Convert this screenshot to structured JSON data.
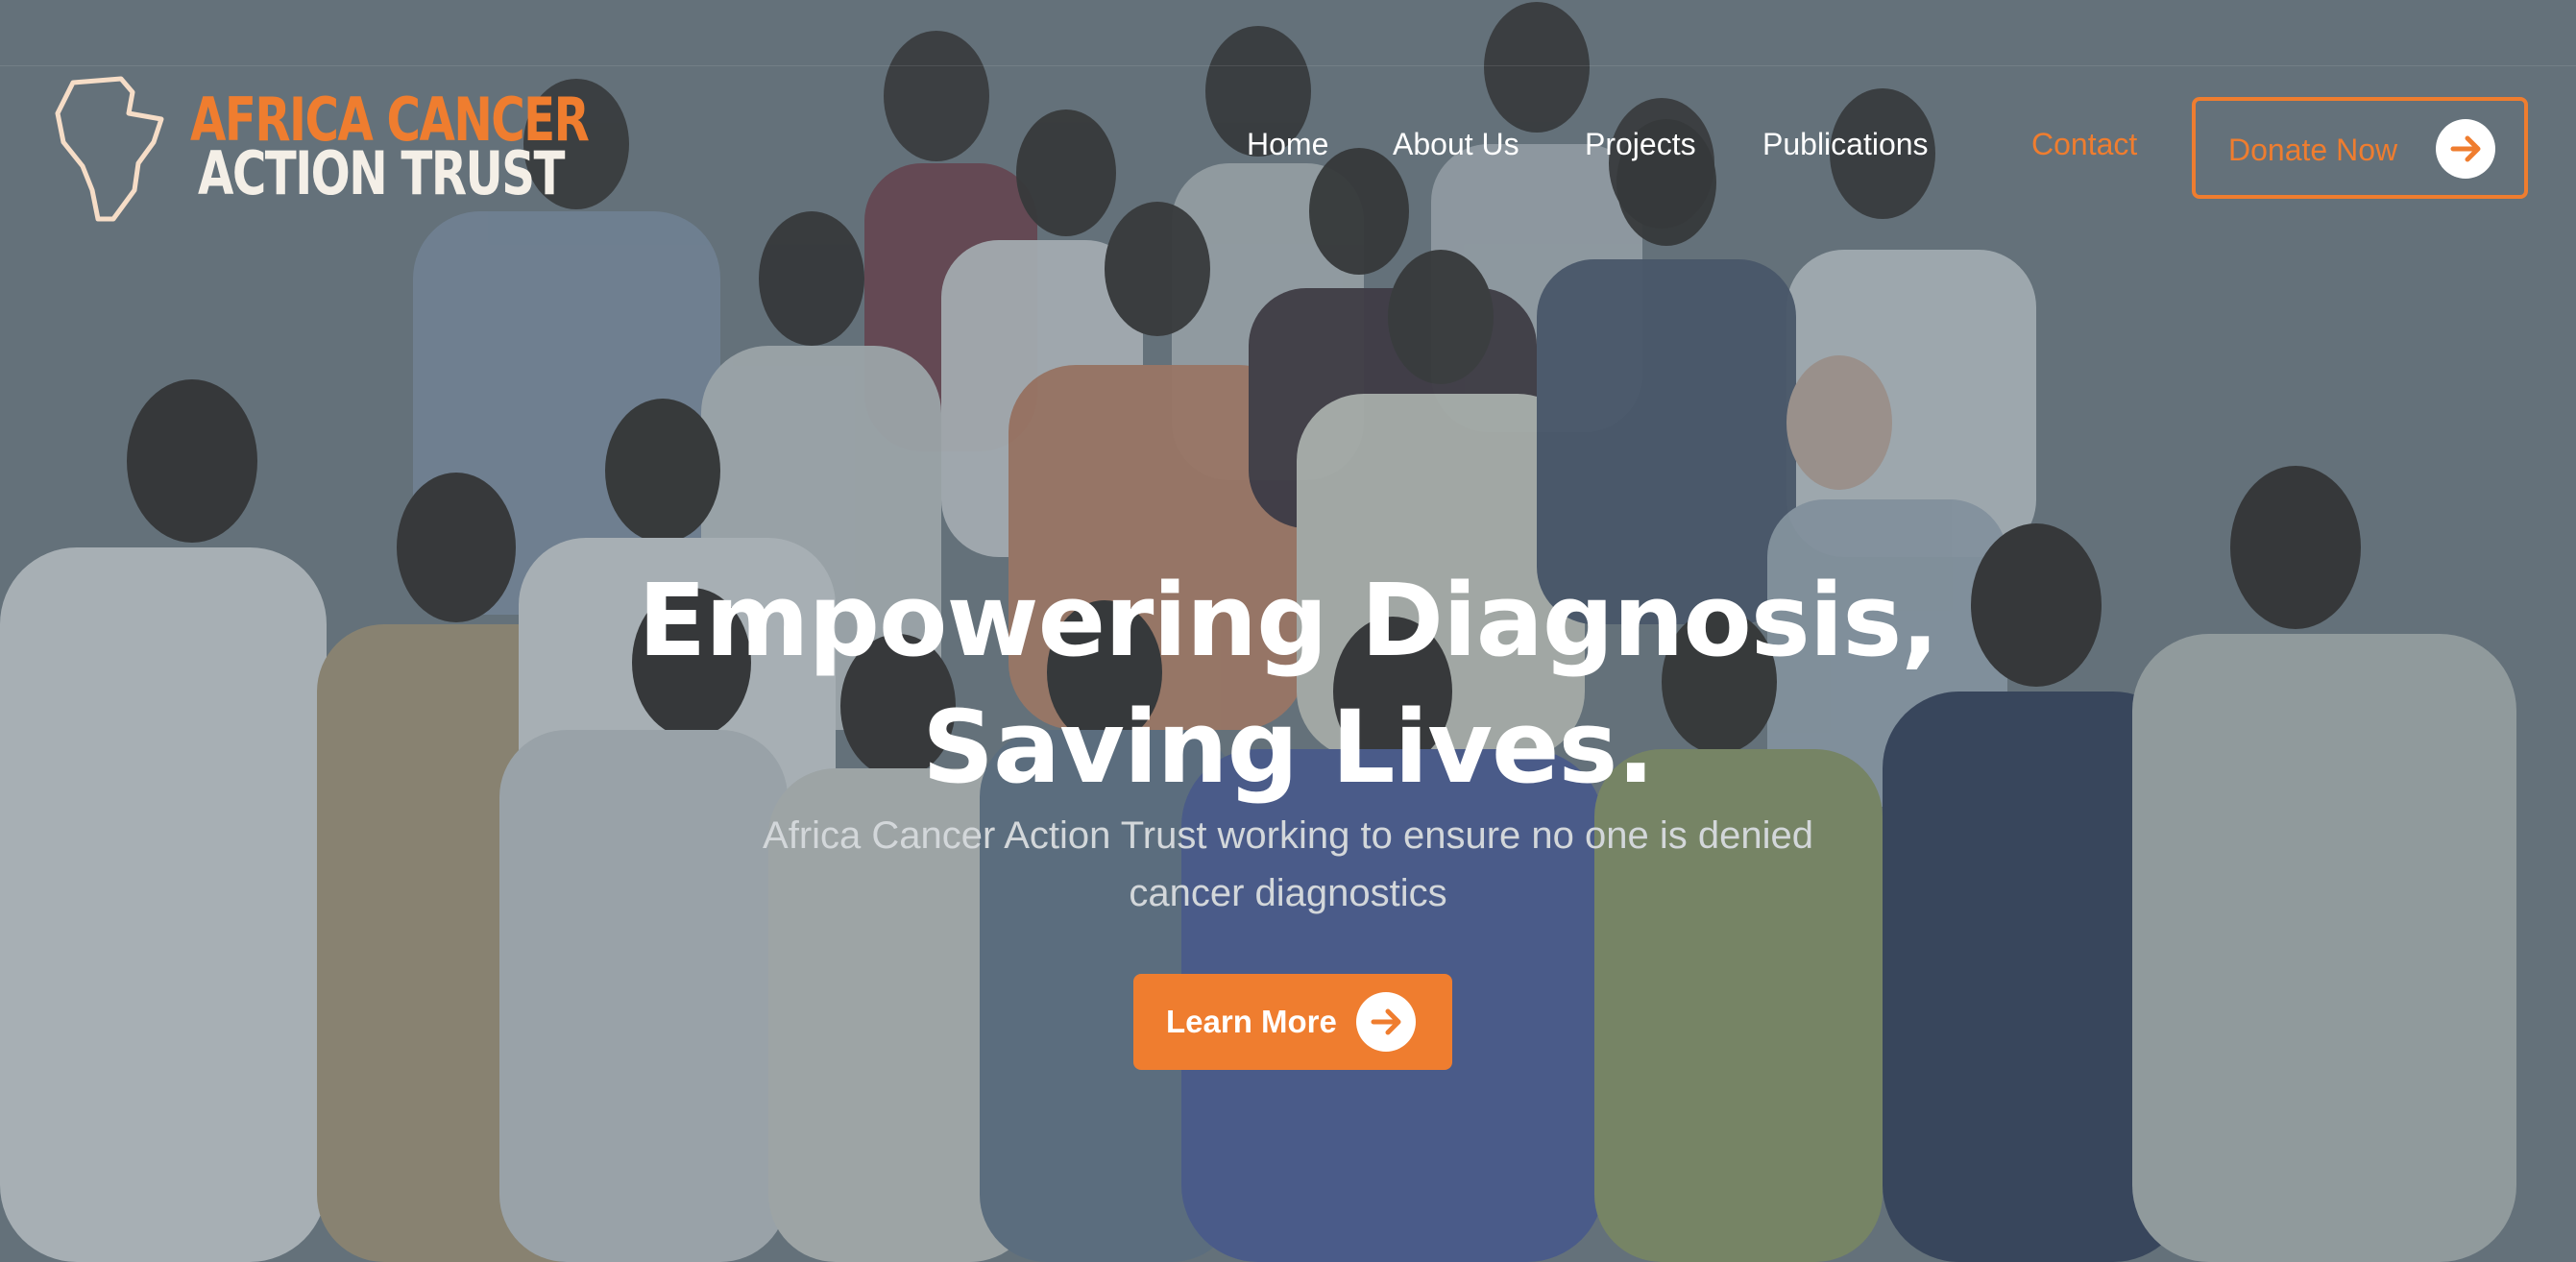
{
  "brand": {
    "line1": "AFRICA CANCER",
    "line2": "ACTION TRUST",
    "accent_color": "#ef7d2f"
  },
  "nav": {
    "items": [
      {
        "label": "Home"
      },
      {
        "label": "About Us"
      },
      {
        "label": "Projects"
      },
      {
        "label": "Publications"
      },
      {
        "label": "Contact"
      }
    ],
    "donate_label": "Donate Now",
    "donate_icon": "arrow-right-icon"
  },
  "hero": {
    "title_line1": "Empowering Diagnosis,",
    "title_line2": "Saving Lives.",
    "subtitle": "Africa Cancer Action Trust working to ensure no one is denied cancer diagnostics",
    "cta_label": "Learn More",
    "cta_icon": "arrow-right-icon"
  }
}
